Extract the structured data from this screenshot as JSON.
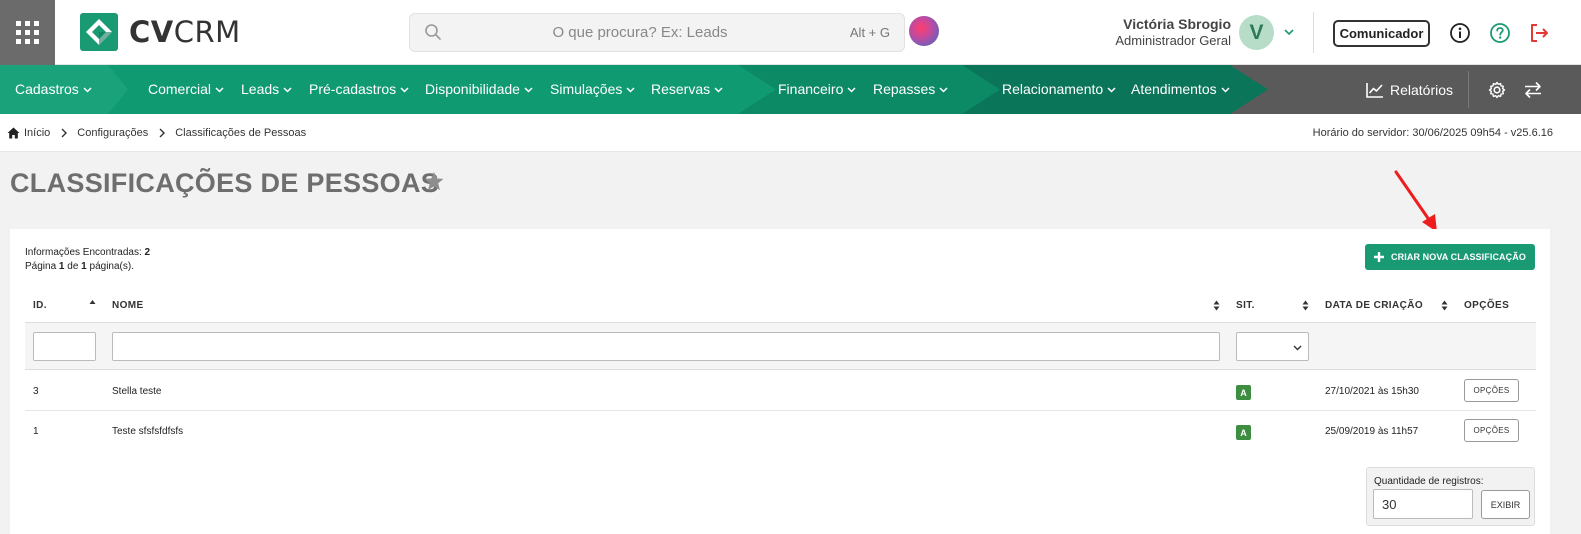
{
  "header": {
    "logo_bold": "CV",
    "logo_light": "CRM",
    "search": {
      "placeholder": "O que procura? Ex: Leads",
      "shortcut": "Alt + G"
    },
    "user": {
      "name": "Victória Sbrogio",
      "role": "Administrador Geral",
      "avatar_letter": "V"
    },
    "comunicador_label": "Comunicador",
    "icons": [
      "apps-grid-icon",
      "search-icon",
      "chevron-down-icon",
      "info-icon",
      "help-icon",
      "logout-icon"
    ],
    "colors": {
      "brand_green": "#1a9a73",
      "help_green": "#1a9a73",
      "logout_red": "#e53935"
    }
  },
  "nav": {
    "groups": [
      {
        "color": "#1aa37a",
        "items": [
          "Cadastros"
        ]
      },
      {
        "color": "#0f9a71",
        "items": [
          "Comercial",
          "Leads",
          "Pré-cadastros",
          "Disponibilidade",
          "Simulações",
          "Reservas"
        ]
      },
      {
        "color": "#0c8a66",
        "items": [
          "Financeiro",
          "Repasses"
        ]
      },
      {
        "color": "#0a7559",
        "items": [
          "Relacionamento",
          "Atendimentos"
        ]
      }
    ],
    "reports_label": "Relatórios",
    "right_icons": [
      "chart-line-icon",
      "gear-icon",
      "swap-arrows-icon"
    ]
  },
  "breadcrumb": {
    "items": [
      "Início",
      "Configurações",
      "Classificações de Pessoas"
    ],
    "server_time": "Horário do servidor: 30/06/2025 09h54 - v25.6.16"
  },
  "page": {
    "title": "CLASSIFICAÇÕES DE PESSOAS"
  },
  "results": {
    "found_label": "Informações Encontradas:",
    "found_count": "2",
    "page_prefix": "Página",
    "page_current": "1",
    "page_of": "de",
    "page_total": "1",
    "page_suffix": "página(s)."
  },
  "create_button_label": "CRIAR NOVA CLASSIFICAÇÃO",
  "table": {
    "columns": [
      "ID.",
      "NOME",
      "SIT.",
      "DATA DE CRIAÇÃO",
      "OPÇÕES"
    ],
    "rows": [
      {
        "id": "3",
        "name": "Stella teste",
        "status": "A",
        "created": "27/10/2021 às 15h30",
        "action": "OPÇÕES"
      },
      {
        "id": "1",
        "name": "Teste sfsfsfdfsfs",
        "status": "A",
        "created": "25/09/2019 às 11h57",
        "action": "OPÇÕES"
      }
    ]
  },
  "pagination": {
    "qty_label": "Quantidade de registros:",
    "qty_value": "30",
    "exibir_label": "EXIBIR"
  }
}
